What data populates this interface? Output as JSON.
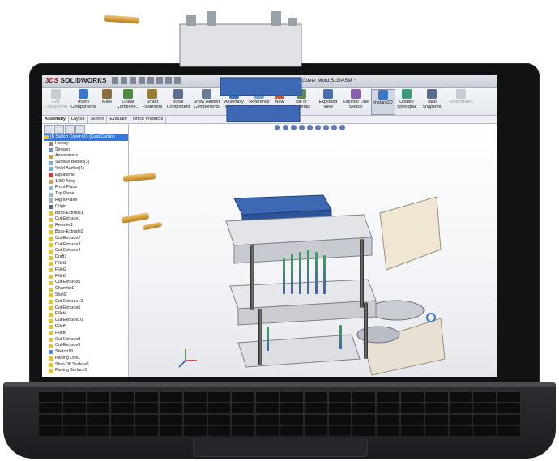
{
  "app": {
    "logo": {
      "ds": "3DS",
      "name": "SOLIDWORKS"
    },
    "document_title": "Switch Cover Mold.SLDASM *"
  },
  "ribbon": {
    "buttons": [
      {
        "id": "edit-component",
        "label": "Edit Component",
        "enabled": false,
        "color": "#9aa0aa"
      },
      {
        "id": "insert-components",
        "label": "Insert Components",
        "enabled": true,
        "color": "#3a77c9"
      },
      {
        "id": "mate",
        "label": "Mate",
        "enabled": true,
        "color": "#8a6d3b"
      },
      {
        "id": "linear-component",
        "label": "Linear Compone...",
        "enabled": true,
        "color": "#4e8a3f"
      },
      {
        "id": "smart-fasteners",
        "label": "Smart Fasteners",
        "enabled": true,
        "color": "#9b7d2f"
      },
      {
        "id": "move-component",
        "label": "Move Component",
        "enabled": true,
        "color": "#5e6f8f"
      },
      {
        "id": "show-hidden",
        "label": "Show Hidden Components",
        "enabled": true,
        "color": "#6b7c96"
      },
      {
        "id": "assembly-features",
        "label": "Assembly Features",
        "enabled": true,
        "color": "#3a77c9"
      },
      {
        "id": "reference-geometry",
        "label": "Reference Geometry",
        "enabled": true,
        "color": "#7aa0d6"
      },
      {
        "id": "new-motion-study",
        "label": "New Motio...",
        "enabled": true,
        "color": "#d05a2b"
      },
      {
        "id": "bill-of-materials",
        "label": "Bill of Materials",
        "enabled": true,
        "color": "#5f8f4e"
      },
      {
        "id": "exploded-view",
        "label": "Exploded View",
        "enabled": true,
        "color": "#4a6fb0"
      },
      {
        "id": "explode-line-sketch",
        "label": "Explode Line Sketch",
        "enabled": true,
        "color": "#8a5fb0"
      },
      {
        "id": "instant3d",
        "label": "Instant3D",
        "enabled": true,
        "color": "#3a77c9"
      },
      {
        "id": "update-speedpak",
        "label": "Update Speedpak",
        "enabled": true,
        "color": "#3a9a7a"
      },
      {
        "id": "take-snapshot",
        "label": "Take Snapshot",
        "enabled": true,
        "color": "#5a6a8a"
      },
      {
        "id": "smartmates",
        "label": "SmartMates",
        "enabled": false,
        "color": "#9aa0aa"
      }
    ]
  },
  "tabs": [
    "Assembly",
    "Layout",
    "Sketch",
    "Evaluate",
    "Office Products"
  ],
  "tree": {
    "items": [
      {
        "label": "(f) Switch Cover<1> (Cast Carbon",
        "icon": "part-icon",
        "color": "#f2c230",
        "selected": true
      },
      {
        "label": "History",
        "icon": "history-icon",
        "color": "#8a8a8a"
      },
      {
        "label": "Sensors",
        "icon": "sensor-icon",
        "color": "#6a8fd0"
      },
      {
        "label": "Annotations",
        "icon": "annotation-icon",
        "color": "#d0a030"
      },
      {
        "label": "Surface Bodies(3)",
        "icon": "surface-icon",
        "color": "#7ab0d6"
      },
      {
        "label": "Solid Bodies(1)",
        "icon": "solid-icon",
        "color": "#7ab0d6"
      },
      {
        "label": "Equations",
        "icon": "equation-icon",
        "color": "#d03a3a"
      },
      {
        "label": "1060 Alloy",
        "icon": "material-icon",
        "color": "#c9a06a"
      },
      {
        "label": "Front Plane",
        "icon": "plane-icon",
        "color": "#9bb4d6"
      },
      {
        "label": "Top Plane",
        "icon": "plane-icon",
        "color": "#9bb4d6"
      },
      {
        "label": "Right Plane",
        "icon": "plane-icon",
        "color": "#9bb4d6"
      },
      {
        "label": "Origin",
        "icon": "origin-icon",
        "color": "#5a6a8a"
      },
      {
        "label": "Boss-Extrude1",
        "icon": "feature-icon",
        "color": "#e6c23a"
      },
      {
        "label": "Cut-Extrude1",
        "icon": "feature-icon",
        "color": "#e6c23a"
      },
      {
        "label": "Revolve1",
        "icon": "feature-icon",
        "color": "#e6c23a"
      },
      {
        "label": "Boss-Extrude2",
        "icon": "feature-icon",
        "color": "#e6c23a"
      },
      {
        "label": "Cut-Extrude2",
        "icon": "feature-icon",
        "color": "#e6c23a"
      },
      {
        "label": "Cut-Extrude3",
        "icon": "feature-icon",
        "color": "#e6c23a"
      },
      {
        "label": "Cut-Extrude4",
        "icon": "feature-icon",
        "color": "#e6c23a"
      },
      {
        "label": "Draft1",
        "icon": "feature-icon",
        "color": "#e6c23a"
      },
      {
        "label": "Fillet1",
        "icon": "fillet-icon",
        "color": "#e6c23a"
      },
      {
        "label": "Fillet2",
        "icon": "fillet-icon",
        "color": "#e6c23a"
      },
      {
        "label": "Fillet3",
        "icon": "fillet-icon",
        "color": "#e6c23a"
      },
      {
        "label": "Cut-Extrude5",
        "icon": "feature-icon",
        "color": "#e6c23a"
      },
      {
        "label": "Chamfer1",
        "icon": "feature-icon",
        "color": "#e6c23a"
      },
      {
        "label": "Shell2",
        "icon": "feature-icon",
        "color": "#e6c23a"
      },
      {
        "label": "Cut-Extrude12",
        "icon": "feature-icon",
        "color": "#e6c23a"
      },
      {
        "label": "Cut-Extrude6",
        "icon": "feature-icon",
        "color": "#e6c23a"
      },
      {
        "label": "Fillet4",
        "icon": "fillet-icon",
        "color": "#e6c23a"
      },
      {
        "label": "Cut-Extrude10",
        "icon": "feature-icon",
        "color": "#e6c23a"
      },
      {
        "label": "Fillet5",
        "icon": "fillet-icon",
        "color": "#e6c23a"
      },
      {
        "label": "Fillet6",
        "icon": "fillet-icon",
        "color": "#e6c23a"
      },
      {
        "label": "Cut-Extrude8",
        "icon": "feature-icon",
        "color": "#e6c23a"
      },
      {
        "label": "Cut-Extrude9",
        "icon": "feature-icon",
        "color": "#e6c23a"
      },
      {
        "label": "Sketch18",
        "icon": "sketch-icon",
        "color": "#5a8ad0"
      },
      {
        "label": "Parting Line1",
        "icon": "parting-icon",
        "color": "#e6c23a"
      },
      {
        "label": "Shut-Off Surface1",
        "icon": "parting-icon",
        "color": "#e6c23a"
      },
      {
        "label": "Parting Surface1",
        "icon": "parting-icon",
        "color": "#e6c23a"
      }
    ]
  },
  "colors": {
    "accent": "#3477d6",
    "plate_blue": "#3c68b4",
    "plate_gray": "#d9dbdf",
    "brass": "#d9a441"
  }
}
